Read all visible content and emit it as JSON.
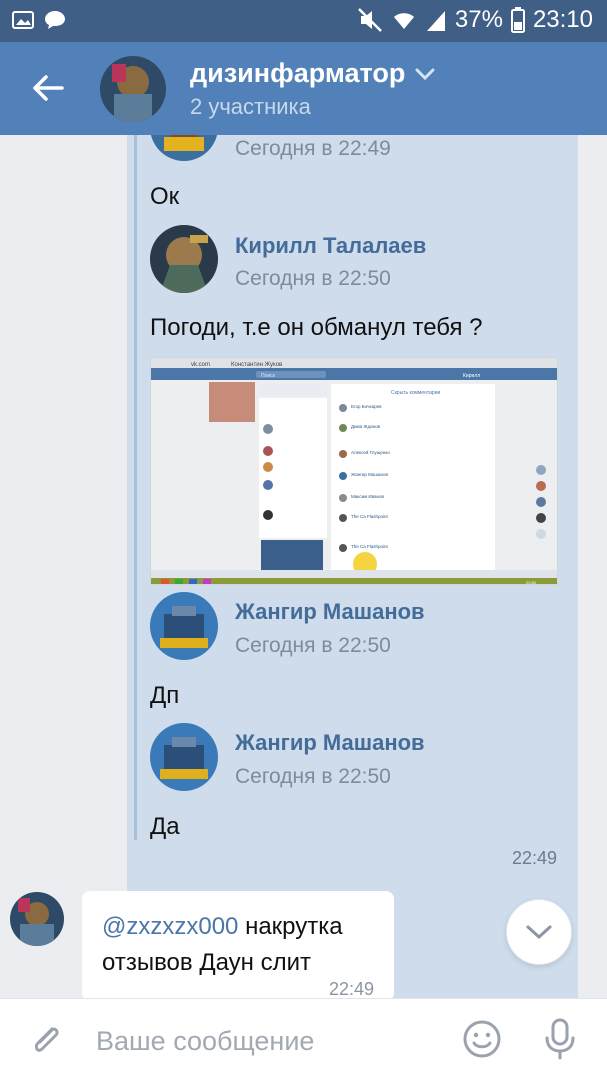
{
  "status_bar": {
    "battery": "37%",
    "time": "23:10"
  },
  "header": {
    "title": "дизинфарматор",
    "subtitle": "2 участника"
  },
  "forwarded_messages": [
    {
      "name": "",
      "date": "Сегодня в 22:49",
      "text": "Ок"
    },
    {
      "name": "Кирилл Талалаев",
      "date": "Сегодня в 22:50",
      "text": "Погоди, т.е он обманул тебя ?"
    },
    {
      "name": "Жангир Машанов",
      "date": "Сегодня в 22:50",
      "text": "Дп"
    },
    {
      "name": "Жангир Машанов",
      "date": "Сегодня в 22:50",
      "text": "Да"
    }
  ],
  "bubble_time": "22:49",
  "incoming": {
    "mention": "@zxzxzx000",
    "text": " накрутка отзывов Даун слит",
    "time": "22:49"
  },
  "input": {
    "placeholder": "Ваше сообщение"
  },
  "screenshot_ui": {
    "url": "vk.com",
    "tab_title": "Константин Жуков",
    "search_placeholder": "Поиск",
    "user_name": "Кирилл",
    "comments_header": "Скрыть комментарии",
    "commenters": [
      "Егор Бочкарев",
      "Дима Жданов",
      "Алексей Глущенко",
      "Жангир Машанов",
      "Максим Иванов",
      "The Ca Flashpoint",
      "The Ca Flashpoint"
    ],
    "clock": "22:50",
    "date": "28.06.2018"
  },
  "colors": {
    "header": "#5181b8",
    "status_bar": "#3f5f86",
    "link": "#436c99",
    "bubble": "#cedcec",
    "chat_bg": "#ebedf0"
  }
}
